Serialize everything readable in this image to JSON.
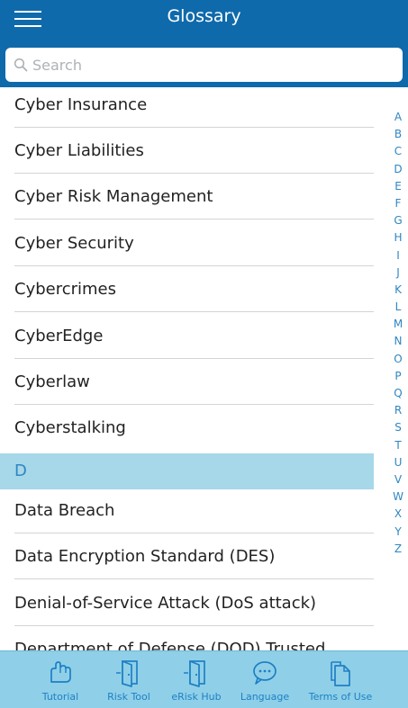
{
  "header": {
    "title": "Glossary"
  },
  "search": {
    "placeholder": "Search"
  },
  "list": {
    "rows_top": [
      "Cyber Insurance",
      "Cyber Liabilities",
      "Cyber Risk Management",
      "Cyber Security",
      "Cybercrimes",
      "CyberEdge",
      "Cyberlaw",
      "Cyberstalking"
    ],
    "section_header": "D",
    "rows_bottom": [
      "Data Breach",
      "Data Encryption Standard (DES)",
      "Denial-of-Service Attack (DoS attack)",
      "Department of Defense (DOD) Trusted"
    ]
  },
  "index": [
    "A",
    "B",
    "C",
    "D",
    "E",
    "F",
    "G",
    "H",
    "I",
    "J",
    "K",
    "L",
    "M",
    "N",
    "O",
    "P",
    "Q",
    "R",
    "S",
    "T",
    "U",
    "V",
    "W",
    "X",
    "Y",
    "Z"
  ],
  "tabs": [
    {
      "label": "Tutorial",
      "icon": "hand-icon"
    },
    {
      "label": "Risk Tool",
      "icon": "door-icon"
    },
    {
      "label": "eRisk Hub",
      "icon": "door-icon"
    },
    {
      "label": "Language",
      "icon": "chat-bubble-icon"
    },
    {
      "label": "Terms of Use",
      "icon": "documents-icon"
    }
  ],
  "colors": {
    "header": "#0f6aab",
    "section": "#a6d8e9",
    "accent": "#2f86c2",
    "tabbar": "#8fd0e8"
  }
}
